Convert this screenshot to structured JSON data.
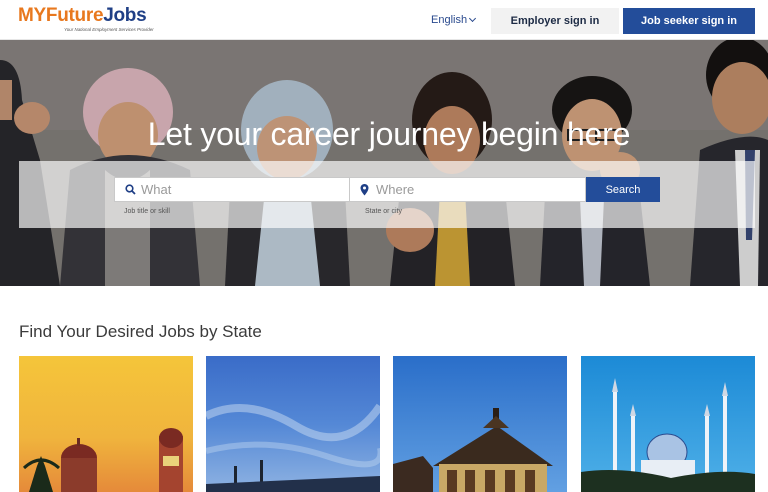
{
  "header": {
    "logo": {
      "part_my": "MY",
      "part_future": "Future",
      "part_jobs": "Jobs",
      "tagline": "Your National Employment Services Provider"
    },
    "language": "English",
    "employer_sign_in": "Employer sign in",
    "job_seeker_sign_in": "Job seeker sign in"
  },
  "hero": {
    "title": "Let your career journey begin here",
    "what_placeholder": "What",
    "what_hint": "Job title or skill",
    "where_placeholder": "Where",
    "where_hint": "State or city",
    "search_label": "Search"
  },
  "states_section": {
    "title": "Find Your Desired Jobs by State",
    "cards": [
      {
        "image": "sultan-abdul-samad-building-photo"
      },
      {
        "image": "blue-sky-towers-photo"
      },
      {
        "image": "traditional-palace-photo"
      },
      {
        "image": "blue-mosque-photo"
      }
    ]
  },
  "colors": {
    "brand_orange": "#e8781e",
    "brand_navy": "#1f3f86",
    "primary_button": "#234d9a",
    "secondary_button": "#f2f2f2"
  }
}
